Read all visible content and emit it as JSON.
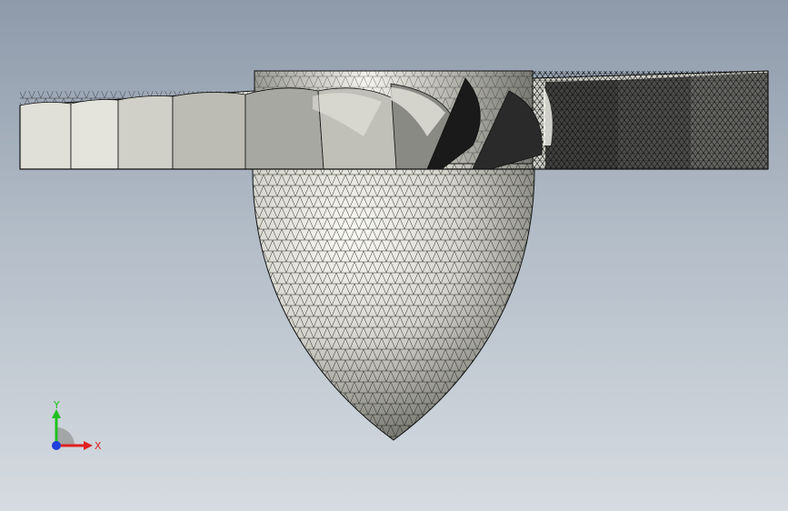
{
  "viewport": {
    "background_top": "#8e9aaa",
    "background_bottom": "#d6dbe1"
  },
  "model": {
    "shaded_color": "#d8d8d0",
    "mesh_color": "#111111"
  },
  "triad": {
    "x_label": "X",
    "y_label": "Y",
    "x_color": "#e02020",
    "y_color": "#20c020",
    "z_color": "#2040e0",
    "icon": "axis-triad-icon"
  }
}
